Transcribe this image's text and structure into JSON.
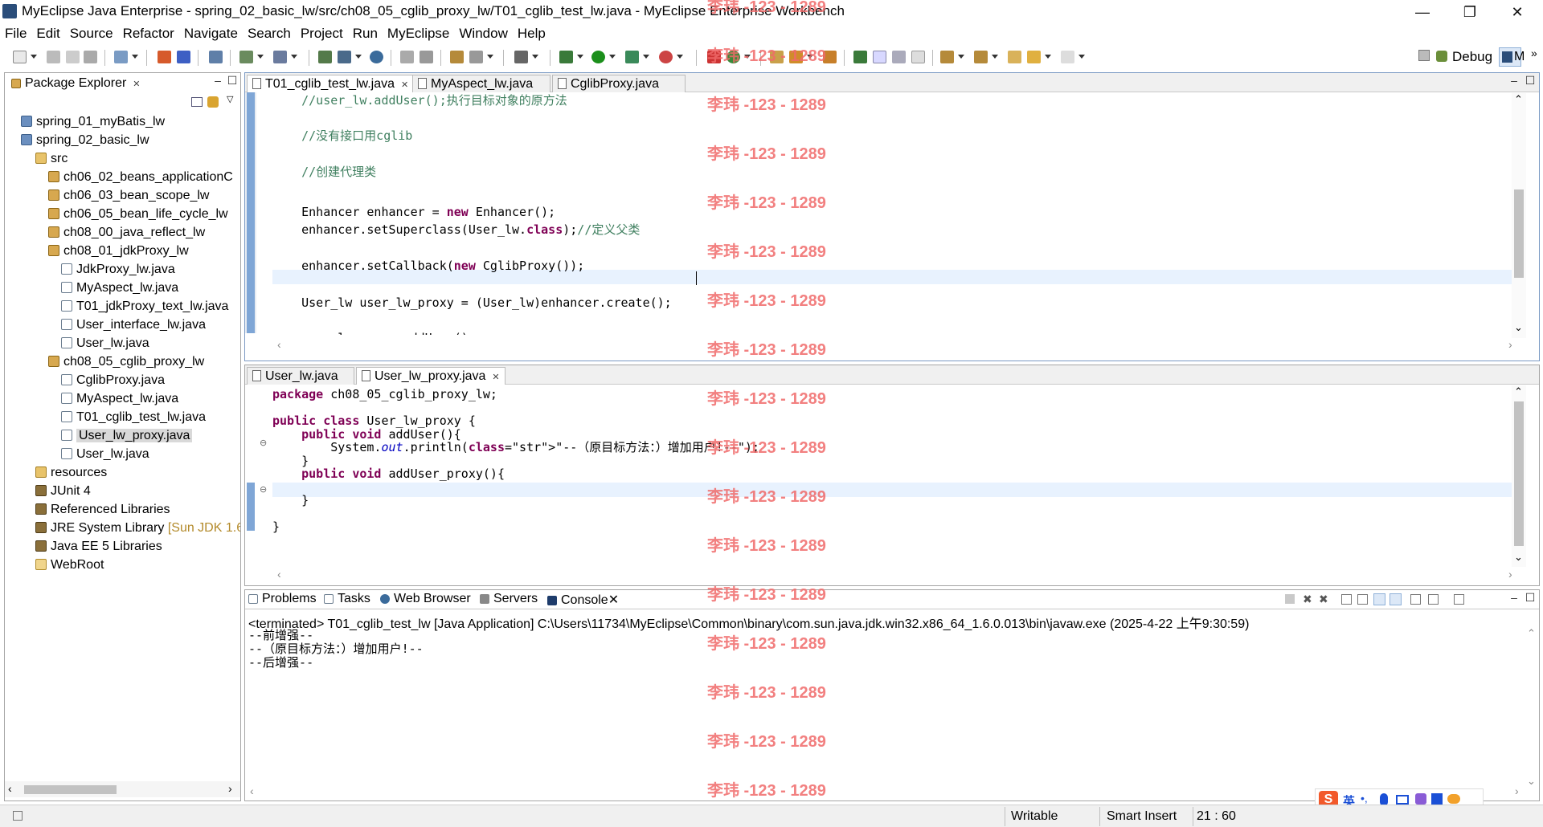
{
  "window": {
    "title": "MyEclipse Java Enterprise - spring_02_basic_lw/src/ch08_05_cglib_proxy_lw/T01_cglib_test_lw.java - MyEclipse Enterprise Workbench",
    "minimize": "—",
    "maximize": "❐",
    "close": "✕"
  },
  "menu": [
    "File",
    "Edit",
    "Source",
    "Refactor",
    "Navigate",
    "Search",
    "Project",
    "Run",
    "MyEclipse",
    "Window",
    "Help"
  ],
  "perspective": {
    "debug_label": "Debug",
    "other_label": "M",
    "more": "»"
  },
  "package_explorer": {
    "title": "Package Explorer",
    "tree": [
      {
        "label": "spring_01_myBatis_lw",
        "icon": "project-icon"
      },
      {
        "label": "spring_02_basic_lw",
        "icon": "project-icon"
      },
      {
        "label": "src",
        "icon": "source-folder-icon"
      },
      {
        "label": "ch06_02_beans_applicationC",
        "icon": "package-icon"
      },
      {
        "label": "ch06_03_bean_scope_lw",
        "icon": "package-icon"
      },
      {
        "label": "ch06_05_bean_life_cycle_lw",
        "icon": "package-icon"
      },
      {
        "label": "ch08_00_java_reflect_lw",
        "icon": "package-icon"
      },
      {
        "label": "ch08_01_jdkProxy_lw",
        "icon": "package-icon"
      },
      {
        "label": "JdkProxy_lw.java",
        "icon": "java-file-icon"
      },
      {
        "label": "MyAspect_lw.java",
        "icon": "java-file-icon"
      },
      {
        "label": "T01_jdkProxy_text_lw.java",
        "icon": "java-file-icon"
      },
      {
        "label": "User_interface_lw.java",
        "icon": "java-file-icon"
      },
      {
        "label": "User_lw.java",
        "icon": "java-file-icon"
      },
      {
        "label": "ch08_05_cglib_proxy_lw",
        "icon": "package-icon"
      },
      {
        "label": "CglibProxy.java",
        "icon": "java-file-icon"
      },
      {
        "label": "MyAspect_lw.java",
        "icon": "java-file-icon"
      },
      {
        "label": "T01_cglib_test_lw.java",
        "icon": "java-file-icon"
      },
      {
        "label": "User_lw_proxy.java",
        "icon": "java-file-icon",
        "selected": true
      },
      {
        "label": "User_lw.java",
        "icon": "java-file-icon"
      },
      {
        "label": "resources",
        "icon": "source-folder-icon"
      },
      {
        "label": "JUnit 4",
        "icon": "library-icon"
      },
      {
        "label": "Referenced Libraries",
        "icon": "library-icon"
      },
      {
        "label": "JRE System Library",
        "suffix": "[Sun JDK 1.6",
        "icon": "library-icon"
      },
      {
        "label": "Java EE 5 Libraries",
        "icon": "library-icon"
      },
      {
        "label": "WebRoot",
        "icon": "folder-icon"
      }
    ]
  },
  "editor_top": {
    "tabs": [
      {
        "label": "T01_cglib_test_lw.java",
        "active": true,
        "closable": true
      },
      {
        "label": "MyAspect_lw.java",
        "active": false
      },
      {
        "label": "CglibProxy.java",
        "active": false
      }
    ],
    "lines": [
      "    //user_lw.addUser();执行目标对象的原方法",
      "",
      "    //没有接口用cglib",
      "",
      "    //创建代理类",
      "",
      "    Enhancer enhancer = new Enhancer();",
      "    enhancer.setSuperclass(User_lw.class);//定义父类",
      "",
      "    enhancer.setCallback(new CglibProxy());",
      "",
      "    User_lw user_lw_proxy = (User_lw)enhancer.create();",
      "",
      "    user_lw_proxy.addUser();",
      "}"
    ]
  },
  "editor_bottom": {
    "tabs": [
      {
        "label": "User_lw.java",
        "active": false
      },
      {
        "label": "User_lw_proxy.java",
        "active": true,
        "closable": true
      }
    ],
    "lines": [
      "package ch08_05_cglib_proxy_lw;",
      "",
      "public class User_lw_proxy {",
      "    public void addUser(){",
      "        System.out.println(\"--（原目标方法：）增加用户!--\");",
      "    }",
      "    public void addUser_proxy(){",
      "",
      "    }",
      "",
      "}"
    ]
  },
  "console": {
    "tabs": [
      "Problems",
      "Tasks",
      "Web Browser",
      "Servers",
      "Console"
    ],
    "header": "<terminated> T01_cglib_test_lw [Java Application] C:\\Users\\11734\\MyEclipse\\Common\\binary\\com.sun.java.jdk.win32.x86_64_1.6.0.013\\bin\\javaw.exe (2025-4-22 上午9:30:59)",
    "output": [
      "--前增强--",
      "--（原目标方法：）增加用户!--",
      "--后增强--"
    ]
  },
  "watermark": "李玮 -123 - 1289",
  "status": {
    "writable": "Writable",
    "insert_mode": "Smart Insert",
    "position": "21 : 60"
  },
  "ime": {
    "lang": "英"
  }
}
